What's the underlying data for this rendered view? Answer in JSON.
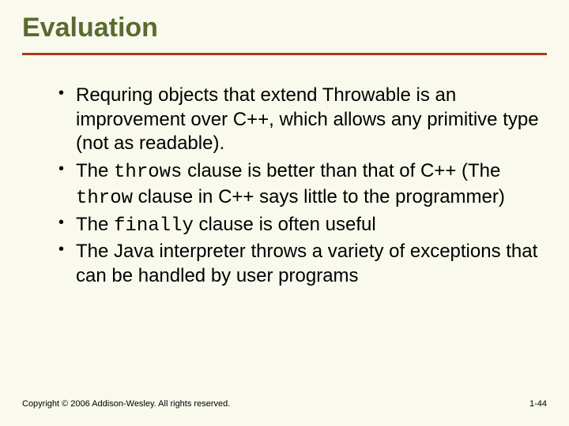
{
  "title": "Evaluation",
  "bullets": [
    {
      "pre": "Requring objects that extend Throwable is an improvement over C++, which allows any primitive type (not as readable).",
      "code1": "",
      "mid": "",
      "code2": "",
      "post": ""
    },
    {
      "pre": "The ",
      "code1": "throws",
      "mid": " clause is better than that of C++ (The ",
      "code2": "throw",
      "post": " clause in C++ says little to the programmer)"
    },
    {
      "pre": "The ",
      "code1": "finally",
      "mid": " clause is often useful",
      "code2": "",
      "post": ""
    },
    {
      "pre": "The Java interpreter throws a variety of exceptions that can be handled by user programs",
      "code1": "",
      "mid": "",
      "code2": "",
      "post": ""
    }
  ],
  "footer": {
    "copyright": "Copyright © 2006 Addison-Wesley. All rights reserved.",
    "page": "1-44"
  }
}
